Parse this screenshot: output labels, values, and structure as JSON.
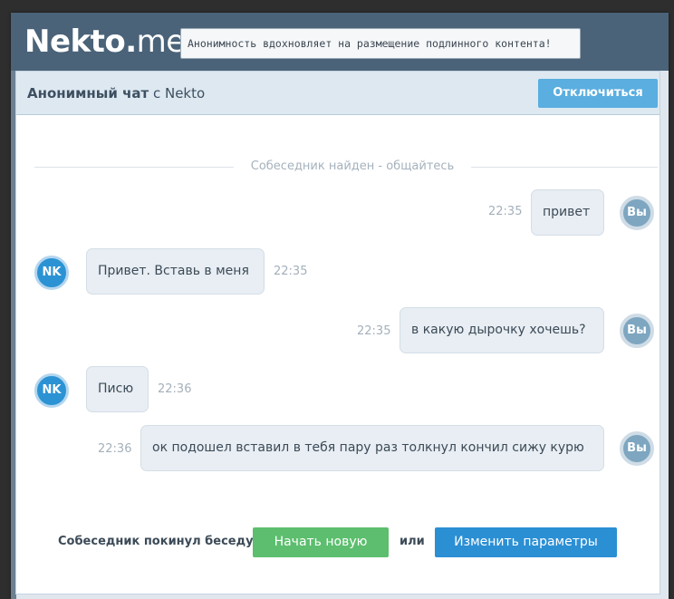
{
  "header": {
    "logo_main": "Nekto",
    "logo_dot": ".",
    "logo_suffix": "me",
    "tagline": "Анонимность вдохновляет на размещение подлинного контента!"
  },
  "chat": {
    "title_strong": "Анонимный чат",
    "title_rest": " с Nekto",
    "disconnect_label": "Отключиться",
    "system_message": "Собеседник найден - общайтесь",
    "avatar_me": "Вы",
    "avatar_partner": "NK",
    "messages": [
      {
        "from": "me",
        "text": "привет",
        "time": "22:35"
      },
      {
        "from": "partner",
        "text": "Привет. Вставь в меня",
        "time": "22:35"
      },
      {
        "from": "me",
        "text": "в какую дырочку хочешь?",
        "time": "22:35"
      },
      {
        "from": "partner",
        "text": "Писю",
        "time": "22:36"
      },
      {
        "from": "me",
        "text": "ок подошел вставил в тебя пару раз толкнул кончил сижу курю",
        "time": "22:36"
      }
    ]
  },
  "footer": {
    "left_label": "Собеседник покинул беседу:",
    "new_chat_label": "Начать новую",
    "or_label": "или",
    "change_params_label": "Изменить параметры"
  },
  "colors": {
    "header_bg": "#4a6379",
    "disconnect_button": "#5aaee0",
    "new_chat_button": "#5cbe6e",
    "change_params_button": "#2b8fd4",
    "partner_avatar": "#2b93d4",
    "my_avatar": "#7ea6c0"
  }
}
